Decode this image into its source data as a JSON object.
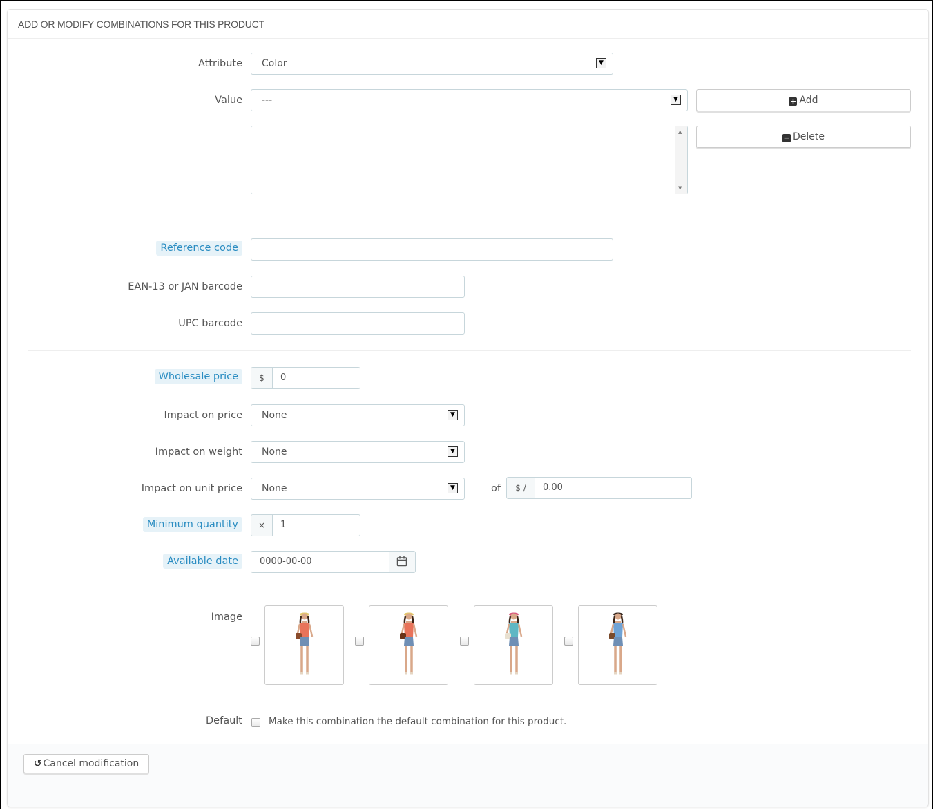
{
  "panel": {
    "title": "ADD OR MODIFY COMBINATIONS FOR THIS PRODUCT"
  },
  "attribute": {
    "label": "Attribute",
    "selected": "Color"
  },
  "value": {
    "label": "Value",
    "selected": "---",
    "add_label": "Add",
    "delete_label": "Delete"
  },
  "reference": {
    "label": "Reference code",
    "value": ""
  },
  "ean": {
    "label": "EAN-13 or JAN barcode",
    "value": ""
  },
  "upc": {
    "label": "UPC barcode",
    "value": ""
  },
  "wholesale": {
    "label": "Wholesale price",
    "currency": "$",
    "value": "0"
  },
  "impact_price": {
    "label": "Impact on price",
    "selected": "None"
  },
  "impact_weight": {
    "label": "Impact on weight",
    "selected": "None"
  },
  "impact_unit_price": {
    "label": "Impact on unit price",
    "selected": "None",
    "of_label": "of",
    "unit_prefix": "$ /",
    "unit_value": "0.00"
  },
  "min_qty": {
    "label": "Minimum quantity",
    "prefix": "×",
    "value": "1"
  },
  "available_date": {
    "label": "Available date",
    "value": "0000-00-00",
    "icon": "calendar-icon"
  },
  "images": {
    "label": "Image",
    "items": [
      {
        "name": "model-photo-1",
        "top_color": "#e8735a",
        "hat_color": "#e3c66b",
        "bag_color": "#8a4a2a",
        "checked": false
      },
      {
        "name": "model-photo-2",
        "top_color": "#e8735a",
        "hat_color": "#e3c66b",
        "bag_color": "#6b3318",
        "checked": false
      },
      {
        "name": "model-photo-3",
        "top_color": "#5fb7c4",
        "hat_color": "#d95a7e",
        "bag_color": "#e8e0d0",
        "checked": false
      },
      {
        "name": "model-photo-4",
        "top_color": "#6fa3d6",
        "hat_color": "#3a2a22",
        "bag_color": "#7a4a2a",
        "checked": false
      }
    ]
  },
  "default": {
    "label": "Default",
    "text": "Make this combination the default combination for this product.",
    "checked": false
  },
  "footer": {
    "cancel_label": "Cancel modification"
  }
}
